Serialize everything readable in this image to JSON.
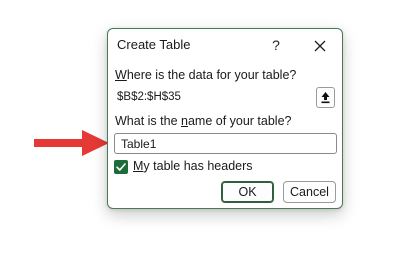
{
  "dialog": {
    "title": "Create Table",
    "help_glyph": "?",
    "where_label_prefix": "W",
    "where_label_rest": "here is the data for your table?",
    "range_value": "$B$2:$H$35",
    "name_label_before": "What is the ",
    "name_label_accel": "n",
    "name_label_after": "ame of your table?",
    "name_value": "Table1",
    "headers_checked": true,
    "headers_label_prefix": "M",
    "headers_label_rest": "y table has headers",
    "ok_label": "OK",
    "cancel_label": "Cancel"
  },
  "icons": {
    "close": "close-icon",
    "collapse": "upload-arrow-icon",
    "check": "checkmark-icon",
    "pointer": "red-arrow-icon"
  },
  "colors": {
    "accent": "#1e6b3a",
    "arrow": "#e53935"
  }
}
